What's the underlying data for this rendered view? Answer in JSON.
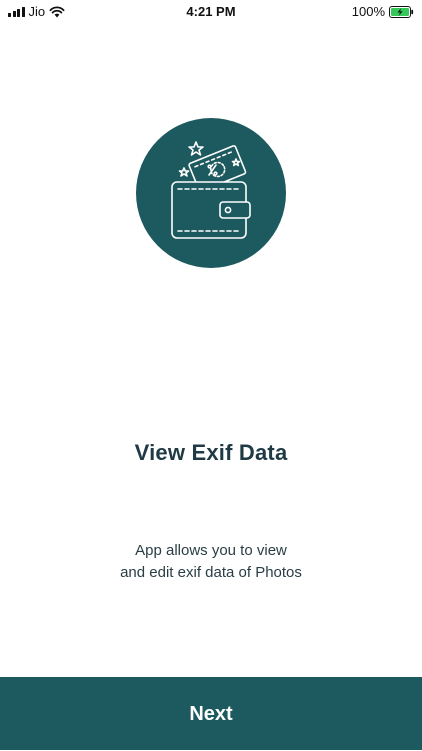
{
  "status_bar": {
    "carrier": "Jio",
    "time": "4:21 PM",
    "battery": "100%",
    "icons": [
      "signal-icon",
      "wifi-icon",
      "battery-charging-icon"
    ]
  },
  "onboarding": {
    "illustration": "wallet-icon",
    "title": "View Exif Data",
    "description_line1": "App allows you to view",
    "description_line2": "and edit exif data of Photos"
  },
  "footer": {
    "next_label": "Next"
  },
  "colors": {
    "accent": "#1d5a60",
    "title_text": "#1f3a44",
    "battery": "#34c759"
  }
}
